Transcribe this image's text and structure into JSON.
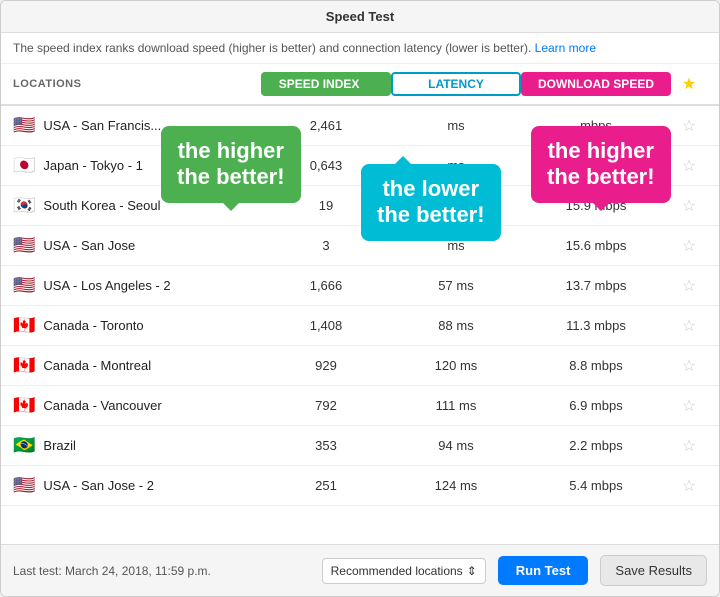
{
  "window": {
    "title": "Speed Test",
    "info_text": "The speed index ranks download speed (higher is better) and connection latency (lower is better).",
    "learn_more": "Learn more"
  },
  "header": {
    "locations_label": "LOCATIONS",
    "speed_index_label": "SPEED INDEX",
    "latency_label": "LATENCY",
    "download_speed_label": "DOWNLOAD SPEED"
  },
  "callouts": {
    "green_line1": "the higher",
    "green_line2": "the better!",
    "cyan_line1": "the lower",
    "cyan_line2": "the better!",
    "pink_line1": "the higher",
    "pink_line2": "the better!"
  },
  "rows": [
    {
      "flag": "🇺🇸",
      "location": "USA - San Francis...",
      "speed_index": "2,461",
      "latency": "ms",
      "download": "mbps",
      "star": false
    },
    {
      "flag": "🇯🇵",
      "location": "Japan - Tokyo - 1",
      "speed_index": "0,643",
      "latency": "ms",
      "download": "mbps",
      "star": false
    },
    {
      "flag": "🇰🇷",
      "location": "South Korea - Seoul",
      "speed_index": "19",
      "latency": "ms",
      "download": "15.9 mbps",
      "star": false
    },
    {
      "flag": "🇺🇸",
      "location": "USA - San Jose",
      "speed_index": "3",
      "latency": "ms",
      "download": "15.6 mbps",
      "star": false
    },
    {
      "flag": "🇺🇸",
      "location": "USA - Los Angeles - 2",
      "speed_index": "1,666",
      "latency": "57 ms",
      "download": "13.7 mbps",
      "star": false
    },
    {
      "flag": "🇨🇦",
      "location": "Canada - Toronto",
      "speed_index": "1,408",
      "latency": "88 ms",
      "download": "11.3 mbps",
      "star": false
    },
    {
      "flag": "🇨🇦",
      "location": "Canada - Montreal",
      "speed_index": "929",
      "latency": "120 ms",
      "download": "8.8 mbps",
      "star": false
    },
    {
      "flag": "🇨🇦",
      "location": "Canada - Vancouver",
      "speed_index": "792",
      "latency": "111 ms",
      "download": "6.9 mbps",
      "star": false
    },
    {
      "flag": "🇧🇷",
      "location": "Brazil",
      "speed_index": "353",
      "latency": "94 ms",
      "download": "2.2 mbps",
      "star": false
    },
    {
      "flag": "🇺🇸",
      "location": "USA - San Jose - 2",
      "speed_index": "251",
      "latency": "124 ms",
      "download": "5.4 mbps",
      "star": false
    }
  ],
  "footer": {
    "last_test": "Last test: March 24, 2018, 11:59 p.m.",
    "location_select": "Recommended locations",
    "run_test": "Run Test",
    "save_results": "Save Results"
  }
}
